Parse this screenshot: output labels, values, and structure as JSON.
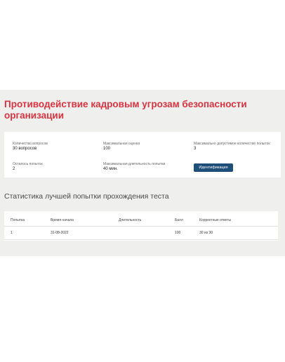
{
  "page": {
    "title": "Противодействие кадровым угрозам безопасности организации"
  },
  "info": {
    "questions_label": "Количество вопросов",
    "questions_value": "30 вопросов",
    "max_score_label": "Максимальная оценка",
    "max_score_value": "100",
    "max_attempts_label": "Максимально допустимое количество попыток",
    "max_attempts_value": "3",
    "attempts_left_label": "Осталось попыток",
    "attempts_left_value": "2",
    "max_duration_label": "Максимальная длительность попытки",
    "max_duration_value": "40 мин.",
    "identify_button": "Идентификация"
  },
  "stats": {
    "title": "Статистика лучшей попытки прохождения теста",
    "columns": [
      "Попытка",
      "Время начала",
      "Длительность",
      "Балл",
      "Корректные ответы"
    ],
    "rows": [
      [
        "1",
        "31-08-2022",
        "",
        "100",
        "30 из 30"
      ]
    ]
  },
  "colors": {
    "title": "#d8333f",
    "button": "#1f4e79",
    "panel_background": "#efefed"
  }
}
